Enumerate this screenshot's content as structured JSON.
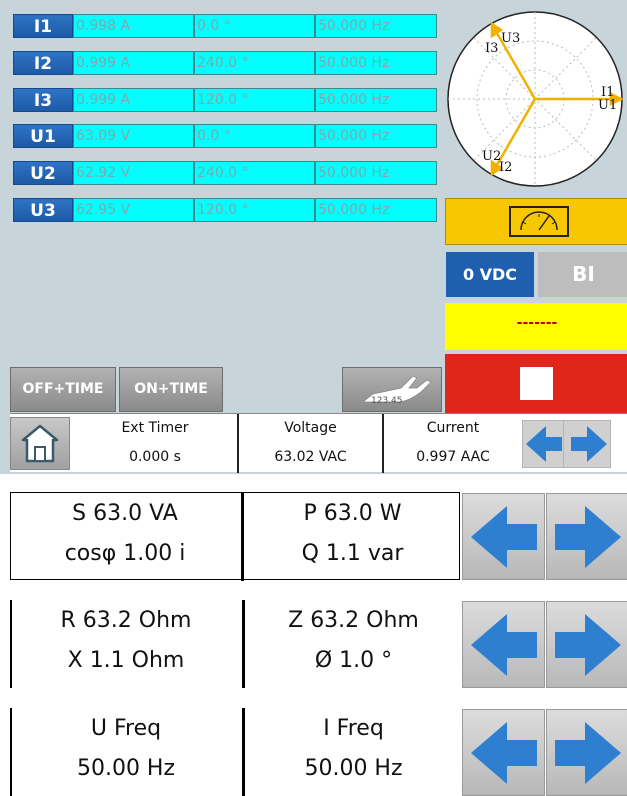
{
  "channels": [
    {
      "label": "I1",
      "magnitude": "0.998 A",
      "angle": "0.0 °",
      "freq": "50.000 Hz"
    },
    {
      "label": "I2",
      "magnitude": "0.999 A",
      "angle": "240.0 °",
      "freq": "50.000 Hz"
    },
    {
      "label": "I3",
      "magnitude": "0.999 A",
      "angle": "120.0 °",
      "freq": "50.000 Hz"
    },
    {
      "label": "U1",
      "magnitude": "63.09 V",
      "angle": "0.0 °",
      "freq": "50.000 Hz"
    },
    {
      "label": "U2",
      "magnitude": "62.92 V",
      "angle": "240.0 °",
      "freq": "50.000 Hz"
    },
    {
      "label": "U3",
      "magnitude": "62.95 V",
      "angle": "120.0 °",
      "freq": "50.000 Hz"
    }
  ],
  "phasor": {
    "labels": {
      "i1": "I1",
      "u1": "U1",
      "i2": "I2",
      "u2": "U2",
      "i3": "I3",
      "u3": "U3"
    },
    "color": "#f2b100"
  },
  "controls": {
    "vdc_label": "0 VDC",
    "bi_label": "BI",
    "dash_text": "-------",
    "off_time_label": "OFF+TIME",
    "on_time_label": "ON+TIME",
    "hand_text": "123.45"
  },
  "status": {
    "ext_timer_title": "Ext Timer",
    "ext_timer_value": "0.000 s",
    "voltage_title": "Voltage",
    "voltage_value": "63.02 VAC",
    "current_title": "Current",
    "current_value": "0.997 AAC"
  },
  "measure_panels": [
    {
      "left_top": "S  63.0 VA",
      "left_bottom": "cosφ  1.00 i",
      "right_top": "P  63.0 W",
      "right_bottom": "Q  1.1 var"
    },
    {
      "left_top": "R  63.2 Ohm",
      "left_bottom": "X  1.1 Ohm",
      "right_top": "Z  63.2 Ohm",
      "right_bottom": "Ø  1.0 °"
    },
    {
      "left_top": "U Freq",
      "left_bottom": "50.00 Hz",
      "right_top": "I Freq",
      "right_bottom": "50.00 Hz"
    }
  ],
  "colors": {
    "accent_blue": "#1f5fb0",
    "cyan_cell": "#00ffff",
    "yellow_box": "#f7c800",
    "stop_red": "#e0251b"
  },
  "icons": [
    "meter-icon",
    "stop-icon",
    "hand-keypad-icon",
    "home-icon",
    "arrow-left-icon",
    "arrow-right-icon"
  ]
}
